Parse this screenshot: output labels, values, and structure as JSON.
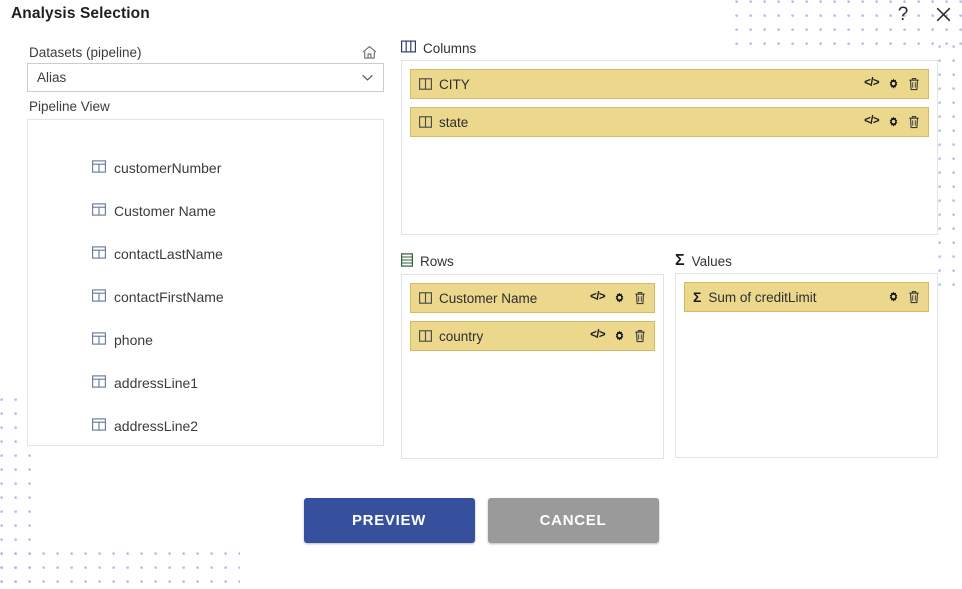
{
  "dialog": {
    "title": "Analysis Selection",
    "help_label": "?",
    "close_label": "close-icon"
  },
  "left": {
    "datasets_label": "Datasets (pipeline)",
    "home_icon": "home-icon",
    "dataset_select": {
      "value": "Alias",
      "placeholder": "Alias",
      "chevron": "chevron-down-icon"
    },
    "pipeline_label": "Pipeline View",
    "pipeline_items": [
      {
        "label": "customerNumber",
        "icon": "table-field-icon"
      },
      {
        "label": "Customer Name",
        "icon": "table-field-icon"
      },
      {
        "label": "contactLastName",
        "icon": "table-field-icon"
      },
      {
        "label": "contactFirstName",
        "icon": "table-field-icon"
      },
      {
        "label": "phone",
        "icon": "table-field-icon"
      },
      {
        "label": "addressLine1",
        "icon": "table-field-icon"
      },
      {
        "label": "addressLine2",
        "icon": "table-field-icon"
      }
    ]
  },
  "columns": {
    "title": "Columns",
    "icon": "columns-icon",
    "chips": [
      {
        "label": "CITY",
        "icon": "column-field-icon",
        "actions": [
          "code-icon",
          "gear-icon",
          "trash-icon"
        ]
      },
      {
        "label": "state",
        "icon": "column-field-icon",
        "actions": [
          "code-icon",
          "gear-icon",
          "trash-icon"
        ]
      }
    ]
  },
  "rows": {
    "title": "Rows",
    "icon": "rows-icon",
    "chips": [
      {
        "label": "Customer Name",
        "icon": "column-field-icon",
        "actions": [
          "code-icon",
          "gear-icon",
          "trash-icon"
        ]
      },
      {
        "label": "country",
        "icon": "column-field-icon",
        "actions": [
          "code-icon",
          "gear-icon",
          "trash-icon"
        ]
      }
    ]
  },
  "values": {
    "title": "Values",
    "icon": "sigma-icon",
    "chips": [
      {
        "label": "Sum of creditLimit",
        "icon": "sigma-icon",
        "actions": [
          "gear-icon",
          "trash-icon"
        ]
      }
    ]
  },
  "footer": {
    "preview_label": "PREVIEW",
    "cancel_label": "CANCEL"
  },
  "colors": {
    "chip_fill": "#ecd88d",
    "chip_border": "#d4bb63",
    "primary_button": "#37509e",
    "secondary_button": "#9a9a9a",
    "dot_pattern": "#aeb6e6"
  }
}
